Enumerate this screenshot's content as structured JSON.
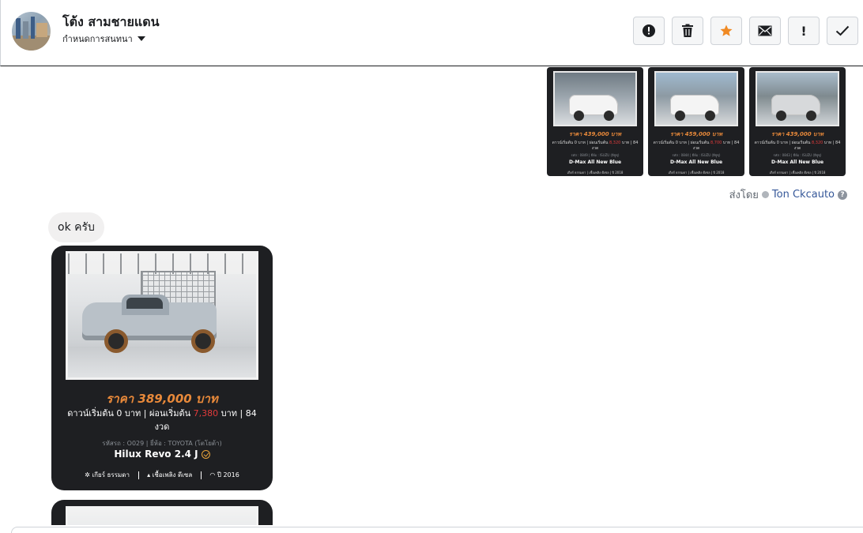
{
  "header": {
    "contact_name": "โต้ง สามชายแดน",
    "conversation_setting": "กำหนดการสนทนา"
  },
  "thumbs": [
    {
      "price": "ราคา 439,000 บาท",
      "terms_prefix": "ดาวน์เริ่มต้น 0 บาท | ผ่อนเริ่มต้น ",
      "terms_highlight": "8,320",
      "terms_suffix": " บาท | 84 งวด",
      "meta": "รหัส : 0849 | ยี่ห้อ : ISUZU (อีซูซุ)",
      "model": "D-Max All New Blue",
      "spec": "เกียร์ ธรรมดา | เชื้อเพลิง ดีเซล | ปี 2018"
    },
    {
      "price": "ราคา 459,000 บาท",
      "terms_prefix": "ดาวน์เริ่มต้น 0 บาท | ผ่อนเริ่มต้น ",
      "terms_highlight": "8,700",
      "terms_suffix": " บาท | 84 งวด",
      "meta": "รหัส : 0844 | ยี่ห้อ : ISUZU (อีซูซุ)",
      "model": "D-Max All New Blue",
      "spec": "เกียร์ ธรรมดา | เชื้อเพลิง ดีเซล | ปี 2018"
    },
    {
      "price": "ราคา 439,000 บาท",
      "terms_prefix": "ดาวน์เริ่มต้น 0 บาท | ผ่อนเริ่มต้น ",
      "terms_highlight": "8,320",
      "terms_suffix": " บาท | 84 งวด",
      "meta": "รหัส : 0843 | ยี่ห้อ : ISUZU (อีซูซุ)",
      "model": "D-Max All New Blue",
      "spec": "เกียร์ ธรรมดา | เชื้อเพลิง ดีเซล | ปี 2018"
    }
  ],
  "sent_by": {
    "label": "ส่งโดย",
    "agent": "Ton Ckcauto"
  },
  "incoming_message": "ok ครับ",
  "card": {
    "price": "ราคา 389,000 บาท",
    "terms_prefix": "ดาวน์เริ่มต้น 0 บาท | ผ่อนเริ่มต้น ",
    "terms_highlight": "7,380",
    "terms_suffix": " บาท | 84 งวด",
    "meta": "รหัสรถ : O029 | ยี่ห้อ : TOYOTA (โตโยต้า)",
    "model": "Hilux Revo 2.4 J",
    "spec_gear": "เกียร์ ธรรมดา",
    "spec_fuel": "เชื้อเพลิง ดีเซล",
    "spec_year": "ปี 2016"
  },
  "colors": {
    "price_orange": "#e8893a",
    "highlight_red": "#e23b3b",
    "card_bg": "#1e1f22",
    "star_orange": "#f08a24"
  }
}
